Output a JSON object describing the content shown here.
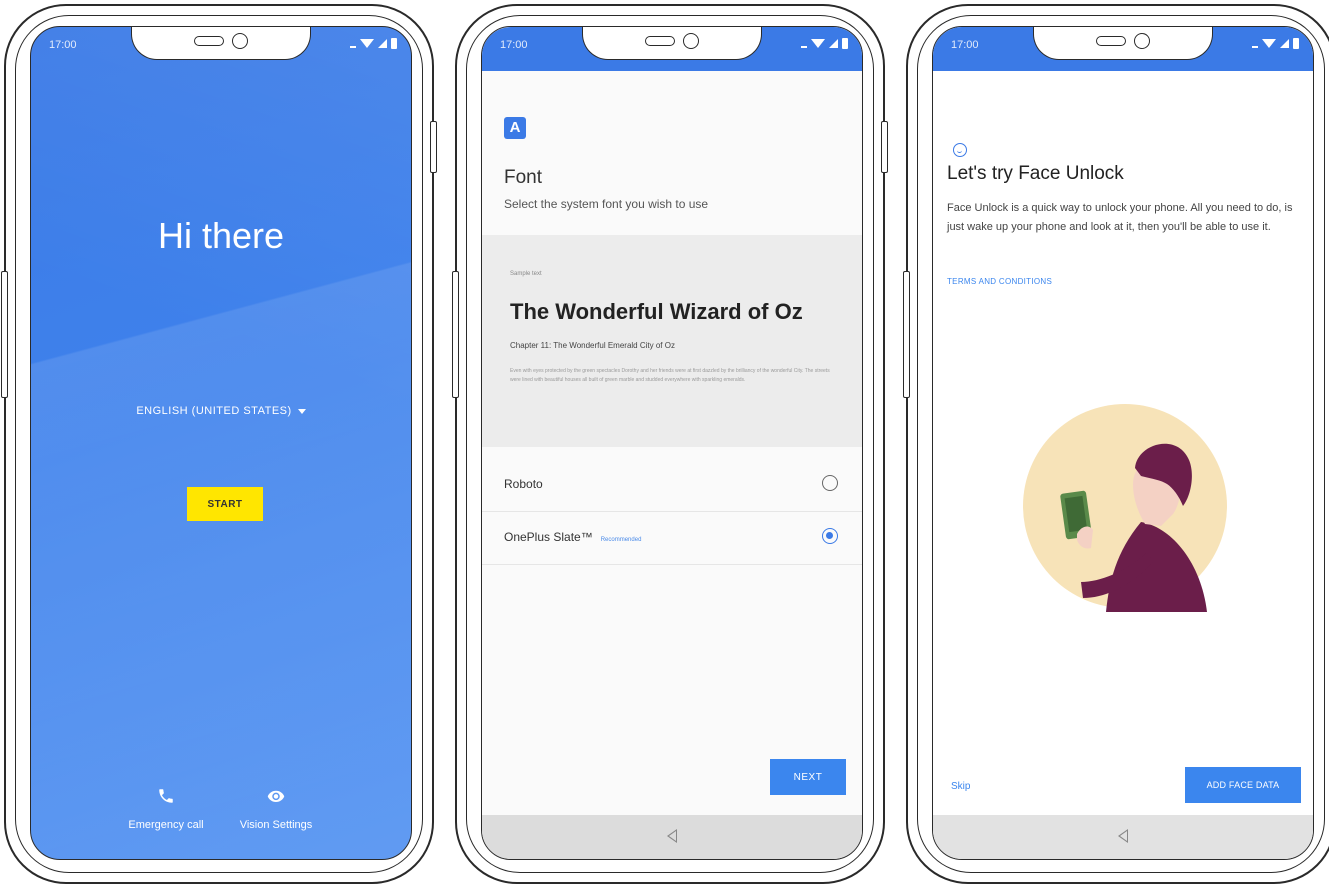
{
  "status": {
    "time": "17:00"
  },
  "screen1": {
    "title": "Hi there",
    "language": "ENGLISH (UNITED STATES)",
    "start_label": "START",
    "emergency_label": "Emergency call",
    "vision_label": "Vision Settings",
    "colors": {
      "background": "#3b7ae6",
      "start_button": "#ffe600"
    }
  },
  "screen2": {
    "icon_letter": "A",
    "title": "Font",
    "subtitle": "Select the system font you wish to use",
    "sample": {
      "caption": "Sample text",
      "title": "The Wonderful Wizard of Oz",
      "chapter": "Chapter 11: The Wonderful Emerald City of Oz",
      "body": "Even with eyes protected by the green spectacles Dorothy and her friends were at first dazzled by the brilliancy of the wonderful City. The streets were lined with beautiful houses all built of green marble and studded everywhere with sparkling emeralds."
    },
    "options": [
      {
        "label": "Roboto",
        "tag": "",
        "selected": false
      },
      {
        "label": "OnePlus Slate™",
        "tag": "Recommended",
        "selected": true
      }
    ],
    "next_label": "NEXT"
  },
  "screen3": {
    "title": "Let's try Face Unlock",
    "description": "Face Unlock is a quick way to unlock your phone. All you need to do, is just wake up your phone and look at it, then you'll be able to use it.",
    "terms_label": "TERMS AND CONDITIONS",
    "skip_label": "Skip",
    "add_face_label": "ADD FACE DATA",
    "colors": {
      "illustration_circle": "#f7e3b8",
      "shirt": "#6b1e4a"
    }
  }
}
